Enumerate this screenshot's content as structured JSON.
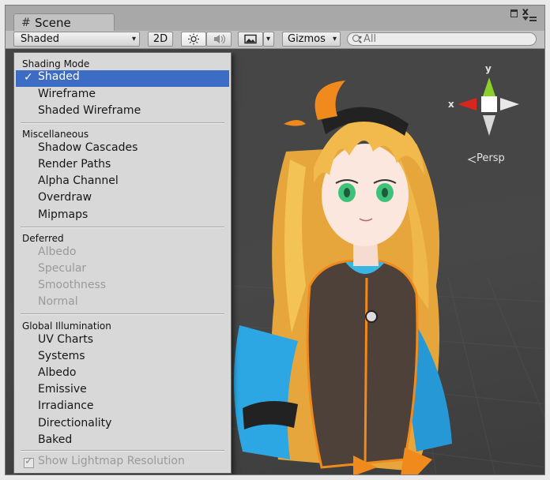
{
  "window": {
    "tab_title": "Scene",
    "grid_icon": "#"
  },
  "toolbar": {
    "shading_select": "Shaded",
    "mode_2d": "2D",
    "gizmos_label": "Gizmos",
    "search_placeholder": "All"
  },
  "viewport": {
    "axis_x": "x",
    "axis_y": "y",
    "projection_label": "Persp"
  },
  "menu": {
    "sections": [
      {
        "title": "Shading Mode"
      },
      {
        "title": "Miscellaneous"
      },
      {
        "title": "Deferred"
      },
      {
        "title": "Global Illumination"
      }
    ],
    "shading": [
      "Shaded",
      "Wireframe",
      "Shaded Wireframe"
    ],
    "selected_check": "✓",
    "misc": [
      "Shadow Cascades",
      "Render Paths",
      "Alpha Channel",
      "Overdraw",
      "Mipmaps"
    ],
    "deferred": [
      "Albedo",
      "Specular",
      "Smoothness",
      "Normal"
    ],
    "gi": [
      "UV Charts",
      "Systems",
      "Albedo",
      "Emissive",
      "Irradiance",
      "Directionality",
      "Baked"
    ],
    "footer": "Show Lightmap Resolution"
  },
  "colors": {
    "selection": "#3d6cc4",
    "axis_x": "#d9261c",
    "axis_y": "#8bd12a"
  }
}
